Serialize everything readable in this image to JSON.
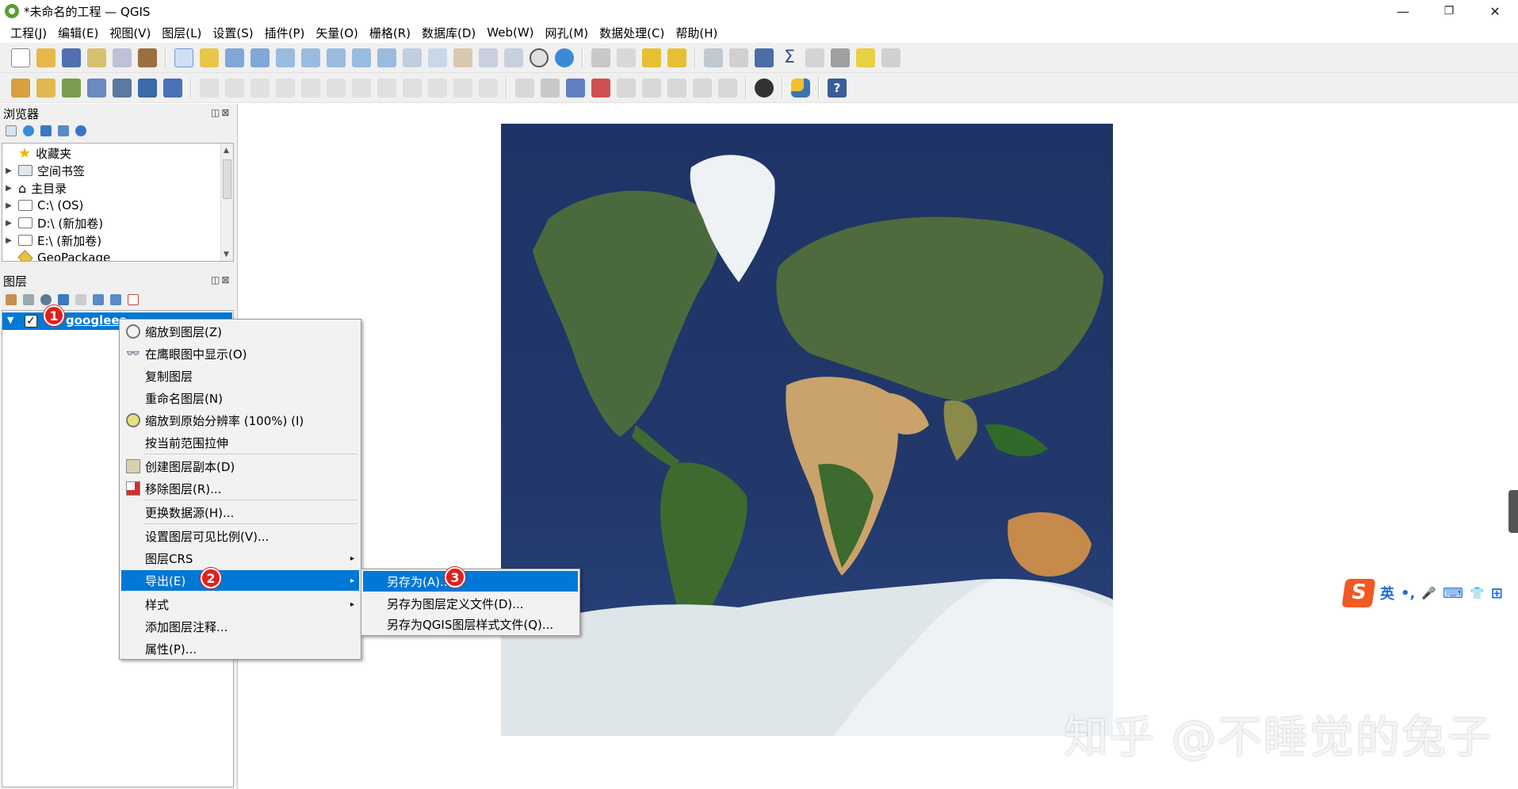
{
  "window": {
    "title": "*未命名的工程 — QGIS",
    "minimize": "—",
    "restore": "❐",
    "close": "✕"
  },
  "menubar": [
    "工程(J)",
    "编辑(E)",
    "视图(V)",
    "图层(L)",
    "设置(S)",
    "插件(P)",
    "矢量(O)",
    "栅格(R)",
    "数据库(D)",
    "Web(W)",
    "网孔(M)",
    "数据处理(C)",
    "帮助(H)"
  ],
  "browser_panel": {
    "title": "浏览器",
    "panel_buttons": "◫⊠",
    "items": [
      {
        "label": "收藏夹",
        "icon": "star-icon"
      },
      {
        "label": "空间书签",
        "icon": "bookmark-icon"
      },
      {
        "label": "主目录",
        "icon": "home-icon"
      },
      {
        "label": "C:\\ (OS)",
        "icon": "folder-icon"
      },
      {
        "label": "D:\\ (新加卷)",
        "icon": "folder-icon"
      },
      {
        "label": "E:\\ (新加卷)",
        "icon": "folder-icon"
      },
      {
        "label": "GeoPackage",
        "icon": "geopackage-icon"
      }
    ]
  },
  "layers_panel": {
    "title": "图层",
    "panel_buttons": "◫⊠",
    "layer": {
      "name": "googleea",
      "checked": "✓"
    }
  },
  "context_menu": {
    "items": [
      {
        "label": "缩放到图层(Z)",
        "icon": "zoom-layer-icon"
      },
      {
        "label": "在鹰眼图中显示(O)",
        "icon": "overview-glasses-icon"
      },
      {
        "label": "复制图层",
        "icon": ""
      },
      {
        "label": "重命名图层(N)",
        "icon": ""
      },
      {
        "label": "缩放到原始分辨率 (100%) (I)",
        "icon": "zoom-native-icon"
      },
      {
        "label": "按当前范围拉伸",
        "icon": ""
      },
      {
        "label": "创建图层副本(D)",
        "icon": "duplicate-layer-icon"
      },
      {
        "label": "移除图层(R)...",
        "icon": "remove-layer-icon"
      },
      {
        "label": "更换数据源(H)...",
        "icon": ""
      },
      {
        "label": "设置图层可见比例(V)...",
        "icon": ""
      },
      {
        "label": "图层CRS",
        "icon": "",
        "submenu": true
      },
      {
        "label": "导出(E)",
        "icon": "",
        "submenu": true,
        "highlighted": true
      },
      {
        "label": "样式",
        "icon": "",
        "submenu": true
      },
      {
        "label": "添加图层注释...",
        "icon": ""
      },
      {
        "label": "属性(P)...",
        "icon": ""
      }
    ],
    "submenu_arrow": "▸"
  },
  "export_submenu": {
    "items": [
      {
        "label": "另存为(A)...",
        "highlighted": true
      },
      {
        "label": "另存为图层定义文件(D)..."
      },
      {
        "label": "另存为QGIS图层样式文件(Q)..."
      }
    ]
  },
  "annotations": {
    "step1": "1",
    "step2": "2",
    "step3": "3"
  },
  "watermark": "知乎 @不睡觉的兔子",
  "ime": {
    "logo": "S",
    "lang": "英",
    "punct": "•,",
    "mic": "🎤",
    "kbd": "⌨",
    "skin": "👕",
    "grid": "⊞"
  },
  "colors": {
    "highlight": "#0078d7",
    "badge": "#e0201e",
    "ocean": "#22386a",
    "land": "#49623a",
    "desert": "#c9a36b",
    "ice": "#e6ecef"
  }
}
